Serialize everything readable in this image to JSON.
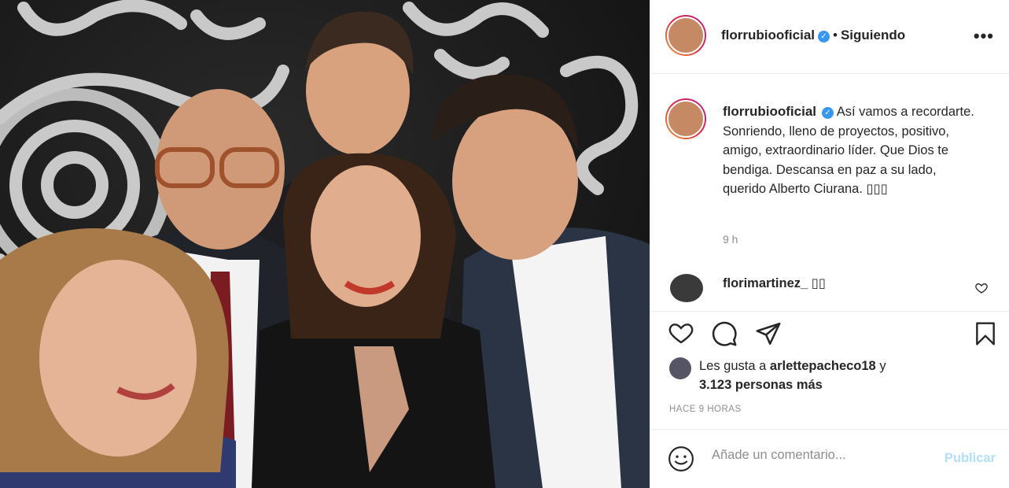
{
  "post": {
    "username": "florrubiooficial",
    "verified_glyph": "✓",
    "separator": "•",
    "follow_status": "Siguiendo",
    "more_label": "•••"
  },
  "caption": {
    "username": "florrubiooficial",
    "text": "Así vamos a recordarte. Sonriendo, lleno de proyectos, positivo, amigo, extraordinario líder. Que Dios te bendiga. Descansa en paz a su lado, querido Alberto Ciurana. ▯▯▯",
    "time": "9 h"
  },
  "comment": {
    "username": "florimartinez_ ▯▯"
  },
  "likes": {
    "prefix": "Les gusta a",
    "user": "arlettepacheco18",
    "connector": "y",
    "others": "3.123 personas más"
  },
  "timestamp": "HACE 9 HORAS",
  "add_comment": {
    "placeholder": "Añade un comentario...",
    "publish": "Publicar"
  },
  "icons": [
    "heart-icon",
    "comment-icon",
    "share-icon",
    "bookmark-icon",
    "emoji-icon",
    "more-icon",
    "verified-icon"
  ],
  "colors": {
    "verified": "#3897f0",
    "publish_disabled": "#b2dffc",
    "muted": "#8e8e8e",
    "text": "#262626"
  }
}
